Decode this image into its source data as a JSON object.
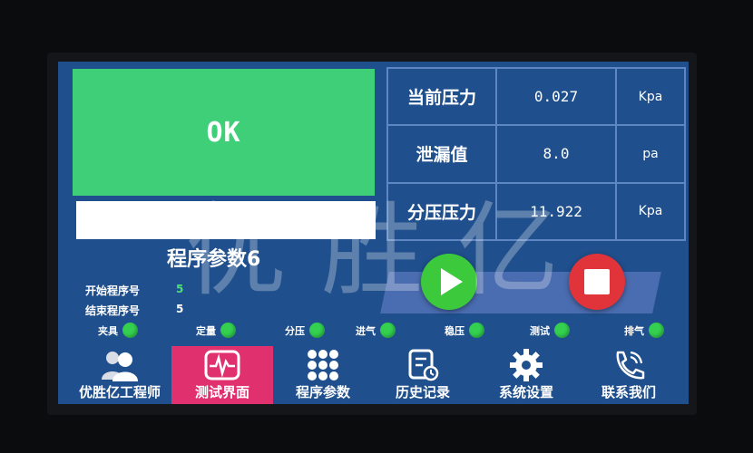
{
  "status": {
    "result": "OK",
    "result_color": "#3fcf78"
  },
  "metrics": [
    {
      "label": "当前压力",
      "value": "0.027",
      "unit": "Kpa"
    },
    {
      "label": "泄漏值",
      "value": "8.0",
      "unit": "pa"
    },
    {
      "label": "分压压力",
      "value": "11.922",
      "unit": "Kpa"
    }
  ],
  "program": {
    "title": "程序参数6",
    "start_label": "开始程序号",
    "start_value": "5",
    "end_label": "结束程序号",
    "end_value": "5"
  },
  "indicators": [
    {
      "label": "夹具",
      "on": true
    },
    {
      "label": "定量",
      "on": true
    },
    {
      "label": "分压",
      "on": true
    },
    {
      "label": "进气",
      "on": true
    },
    {
      "label": "稳压",
      "on": true
    },
    {
      "label": "测试",
      "on": true
    },
    {
      "label": "排气",
      "on": true
    }
  ],
  "controls": {
    "play_icon": "play-icon",
    "stop_icon": "stop-icon"
  },
  "nav": [
    {
      "label": "优胜亿工程师",
      "icon": "users-icon",
      "active": false
    },
    {
      "label": "测试界面",
      "icon": "pulse-monitor-icon",
      "active": true
    },
    {
      "label": "程序参数",
      "icon": "grid-dots-icon",
      "active": false
    },
    {
      "label": "历史记录",
      "icon": "document-clock-icon",
      "active": false
    },
    {
      "label": "系统设置",
      "icon": "gear-icon",
      "active": false
    },
    {
      "label": "联系我们",
      "icon": "phone-icon",
      "active": false
    }
  ],
  "watermark": "优胜亿",
  "colors": {
    "screen_bg": "#1f4f8c",
    "led_on": "#34d04f",
    "play": "#3cc93c",
    "stop": "#e0343a",
    "active_tab": "#e0306e"
  }
}
